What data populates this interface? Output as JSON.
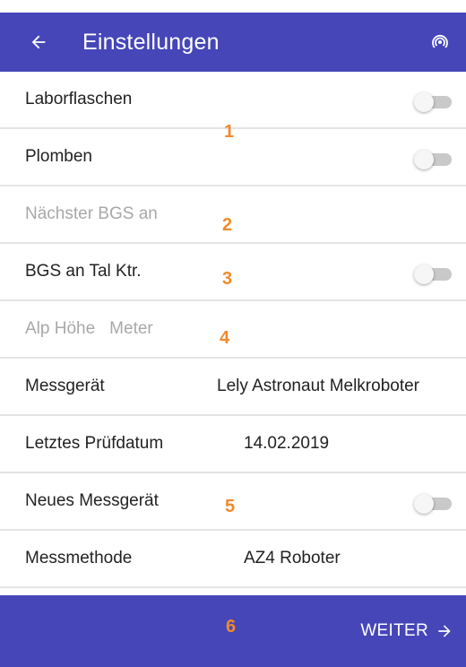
{
  "appbar": {
    "title": "Einstellungen",
    "back_icon": "arrow-left-icon",
    "right_icon": "nfc-icon"
  },
  "settings": [
    {
      "label": "Laborflaschen",
      "type": "toggle",
      "on": false
    },
    {
      "label": "Plomben",
      "type": "toggle",
      "on": false
    },
    {
      "label": "Nächster BGS an",
      "type": "placeholder"
    },
    {
      "label": "BGS an Tal Ktr.",
      "type": "toggle",
      "on": false
    },
    {
      "label": "Alp Höhe",
      "unit": "Meter",
      "type": "placeholder"
    },
    {
      "label": "Messgerät",
      "value": "Lely Astronaut Melkroboter"
    },
    {
      "label": "Letztes Prüfdatum",
      "value": "14.02.2019"
    },
    {
      "label": "Neues Messgerät",
      "type": "toggle",
      "on": false
    },
    {
      "label": "Messmethode",
      "value": "AZ4 Roboter"
    }
  ],
  "markers": [
    "1",
    "2",
    "3",
    "4",
    "5",
    "6"
  ],
  "bottombar": {
    "next_label": "WEITER",
    "next_icon": "arrow-right-icon"
  },
  "colors": {
    "primary": "#4646b9",
    "marker": "#f08a2c",
    "placeholder_text": "#a8a8a8"
  }
}
